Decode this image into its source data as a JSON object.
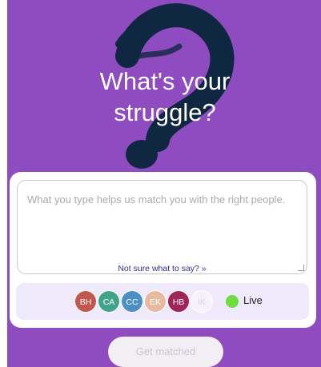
{
  "header": {
    "title_line1": "What's your",
    "title_line2": "struggle?"
  },
  "input": {
    "placeholder": "What you type helps us match you with the right people.",
    "hint_link": "Not sure what to say? »"
  },
  "live_bar": {
    "avatars": [
      {
        "initials": "BH",
        "color": "#c1574f"
      },
      {
        "initials": "CA",
        "color": "#41a48a"
      },
      {
        "initials": "CC",
        "color": "#4d8fc4"
      },
      {
        "initials": "EK",
        "color": "#e7b9a1"
      },
      {
        "initials": "HB",
        "color": "#9e2459"
      },
      {
        "initials": "IK",
        "color": "#f5f2fb"
      }
    ],
    "status_label": "Live",
    "status_color": "#6fdc3f"
  },
  "cta": {
    "label": "Get matched"
  },
  "colors": {
    "background": "#8f4cc0",
    "question_mark": "#0f2740"
  }
}
